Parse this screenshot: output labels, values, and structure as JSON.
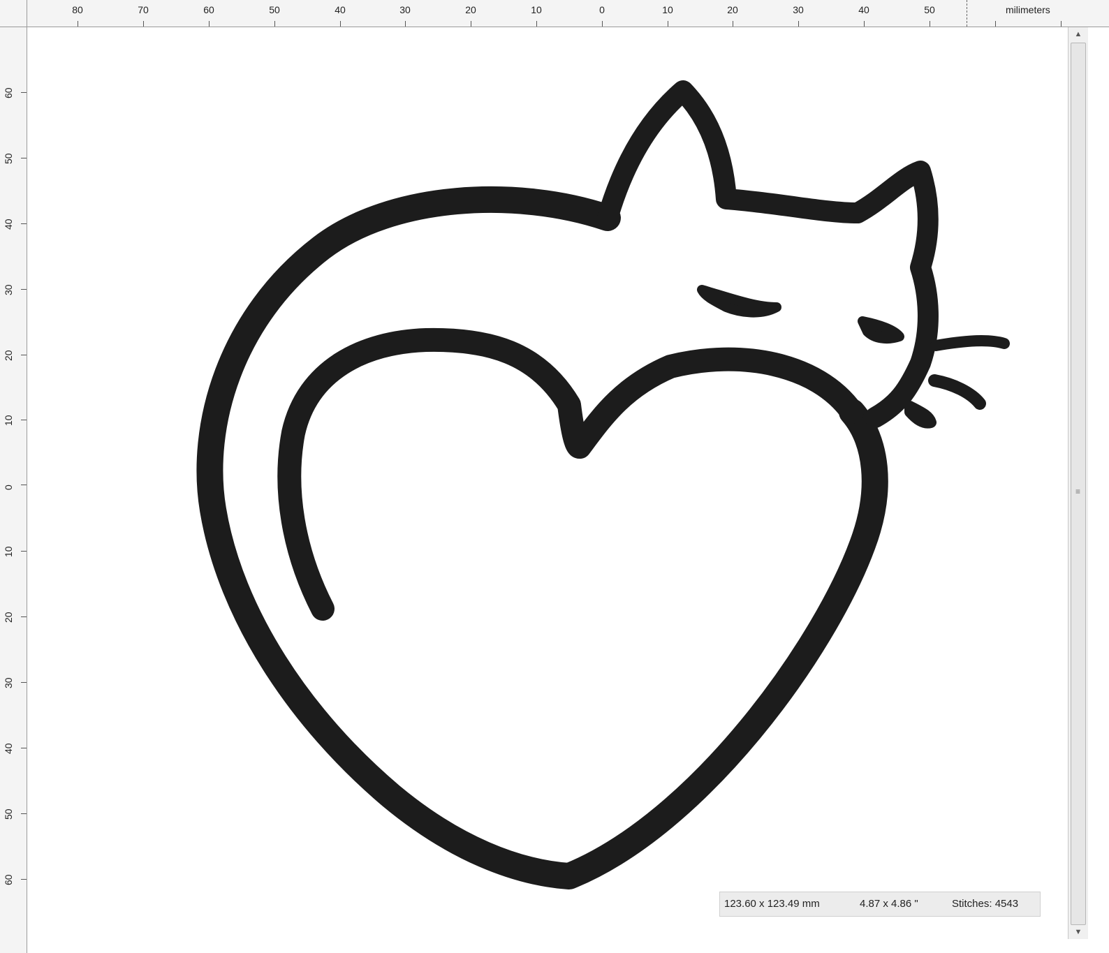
{
  "ruler": {
    "units": "milimeters",
    "top_labels": [
      "80",
      "70",
      "60",
      "50",
      "40",
      "30",
      "20",
      "10",
      "0",
      "10",
      "20",
      "30",
      "40",
      "50"
    ],
    "left_labels": [
      "60",
      "50",
      "40",
      "30",
      "20",
      "10",
      "0",
      "10",
      "20",
      "30",
      "40",
      "50",
      "60"
    ]
  },
  "status": {
    "size_mm": "123.60 x 123.49 mm",
    "size_in": "4.87 x 4.86 \"",
    "stitches": "Stitches: 4543"
  },
  "design": {
    "thread_color": "#1c1c1c"
  },
  "scrollbar": {
    "up_arrow": "▲",
    "down_arrow": "▼",
    "grip": "≡"
  }
}
